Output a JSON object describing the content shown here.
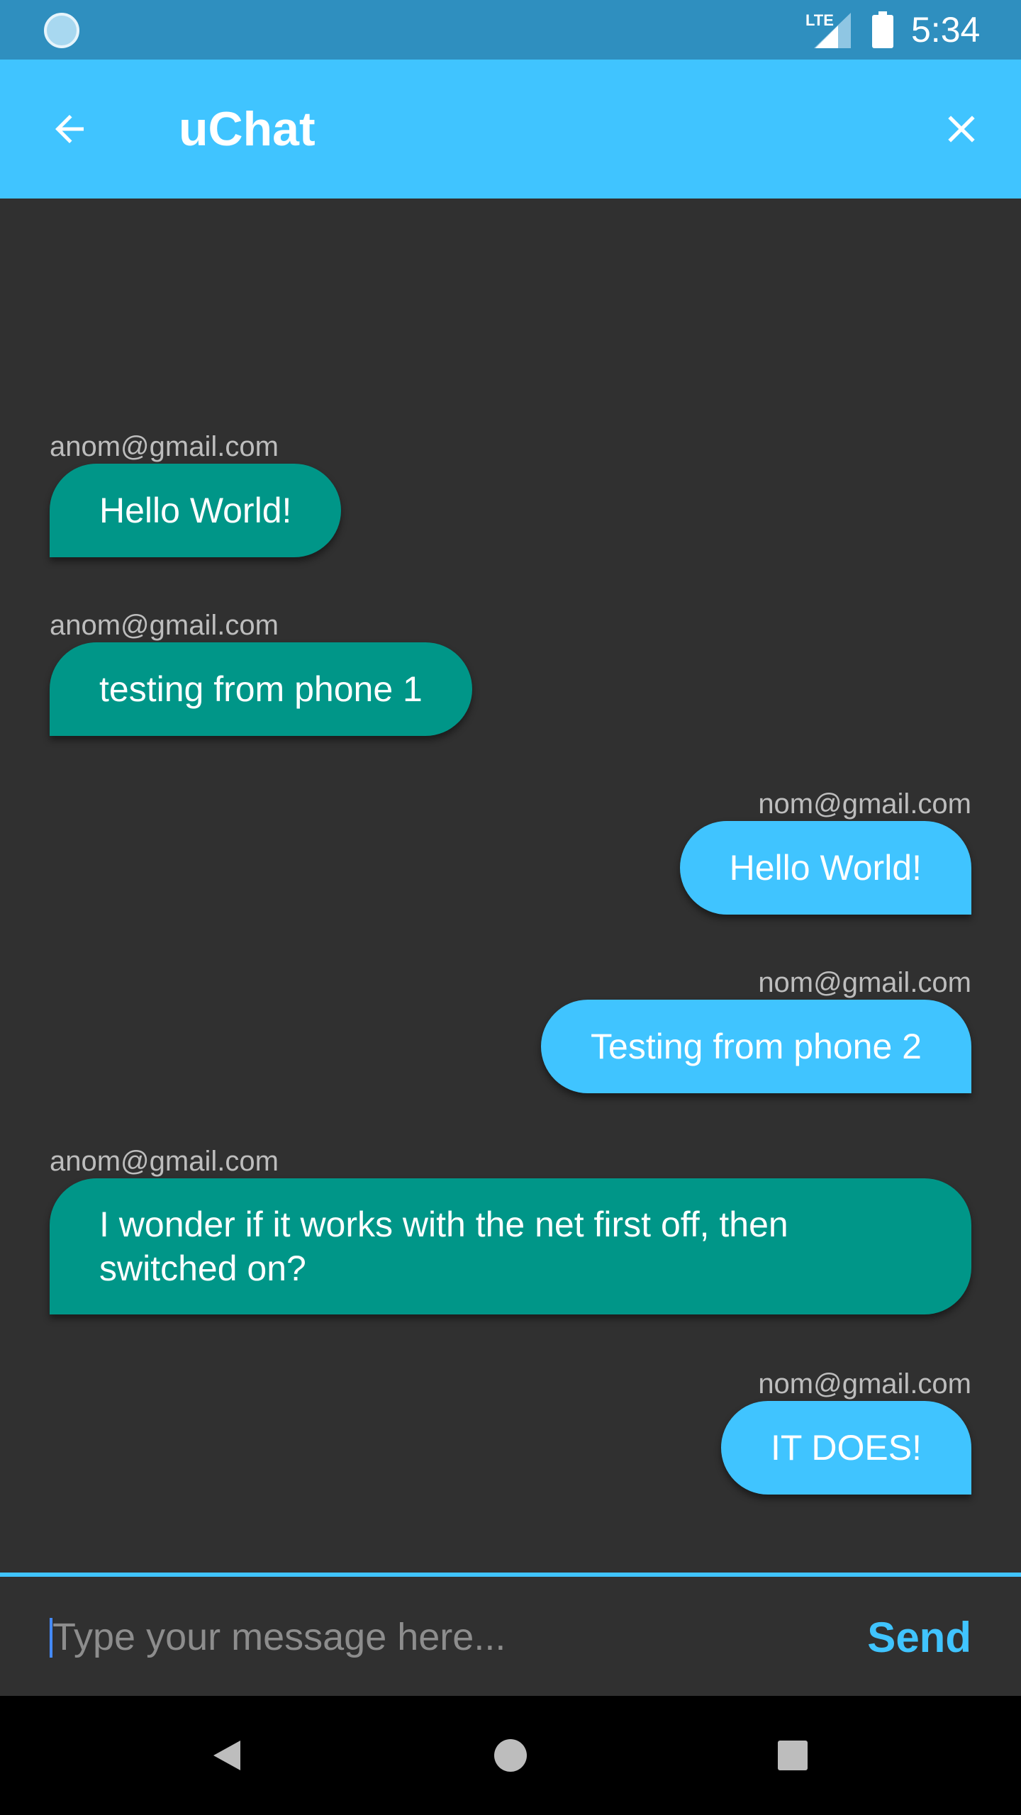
{
  "status_bar": {
    "network_label": "LTE",
    "time": "5:34"
  },
  "app_bar": {
    "title": "uChat",
    "back_icon": "arrow-back-icon",
    "close_icon": "close-icon"
  },
  "messages": [
    {
      "sender": "anom@gmail.com",
      "text": "Hello World!",
      "side": "left"
    },
    {
      "sender": "anom@gmail.com",
      "text": "testing from phone 1",
      "side": "left"
    },
    {
      "sender": "nom@gmail.com",
      "text": "Hello World!",
      "side": "right"
    },
    {
      "sender": "nom@gmail.com",
      "text": "Testing from phone 2",
      "side": "right"
    },
    {
      "sender": "anom@gmail.com",
      "text": "I wonder if it works with the net first off, then switched on?",
      "side": "left"
    },
    {
      "sender": "nom@gmail.com",
      "text": "IT DOES!",
      "side": "right"
    }
  ],
  "composer": {
    "placeholder": "Type your message here...",
    "value": "",
    "send_label": "Send"
  },
  "colors": {
    "accent": "#40c4ff",
    "incoming_bubble": "#009688",
    "background": "#303030",
    "status_bar": "#2f8fbf"
  }
}
